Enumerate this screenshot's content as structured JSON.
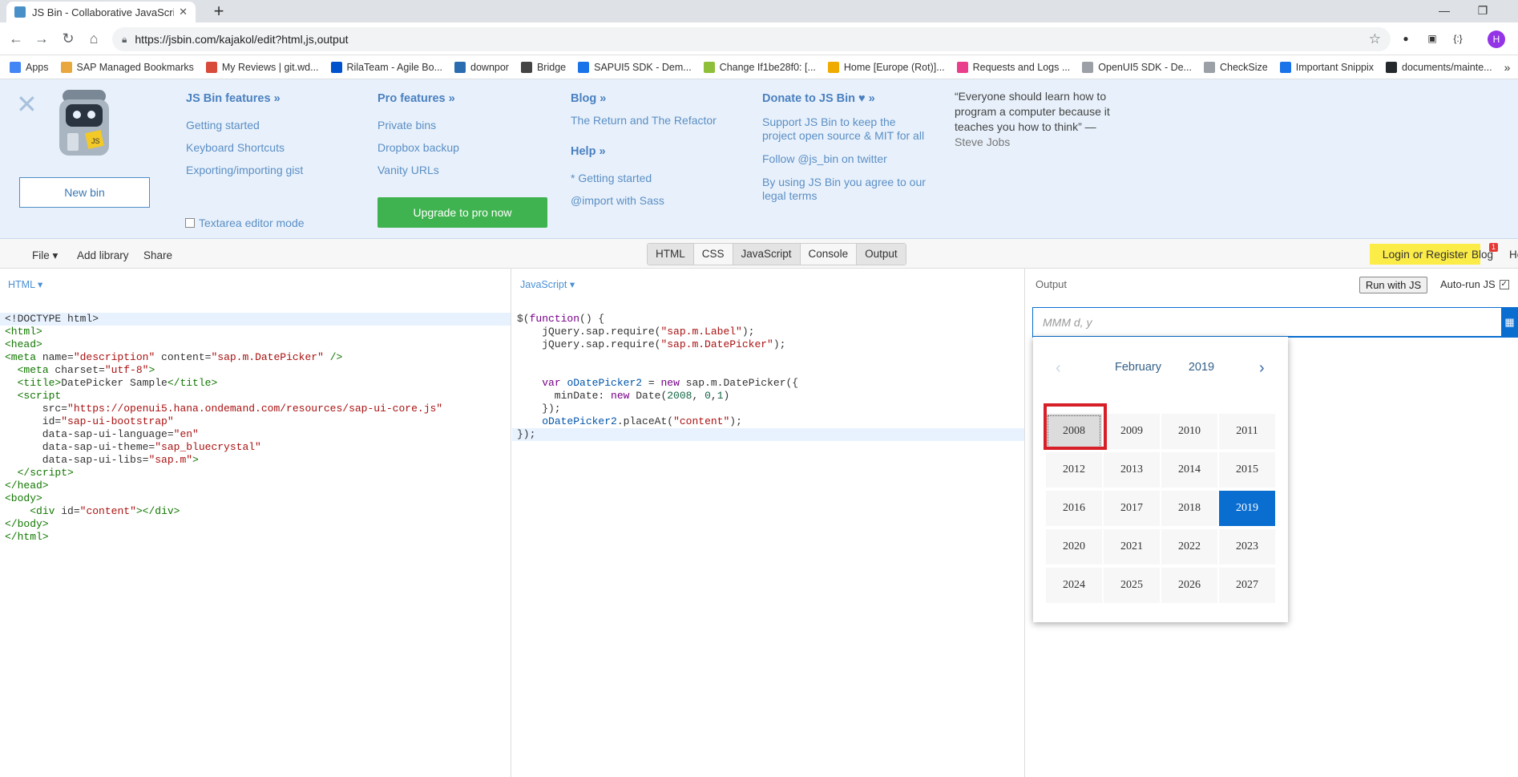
{
  "browser": {
    "tab_title": "JS Bin - Collaborative JavaScript Debugging",
    "url": "https://jsbin.com/kajakol/edit?html,js,output",
    "profile_initial": "H",
    "bookmarks": [
      {
        "label": "Apps",
        "color": "#4285f4"
      },
      {
        "label": "SAP Managed Bookmarks",
        "color": "#e8a83e"
      },
      {
        "label": "My Reviews | git.wd...",
        "color": "#d84a3a"
      },
      {
        "label": "RilaTeam - Agile Bo...",
        "color": "#0052cc"
      },
      {
        "label": "downpor",
        "color": "#2b6cb0"
      },
      {
        "label": "Bridge",
        "color": "#444444"
      },
      {
        "label": "SAPUI5 SDK - Dem...",
        "color": "#1a73e8"
      },
      {
        "label": "Change If1be28f0: [...",
        "color": "#8fbf3a"
      },
      {
        "label": "Home [Europe (Rot)]...",
        "color": "#f0ab00"
      },
      {
        "label": "Requests and Logs ...",
        "color": "#e83e8c"
      },
      {
        "label": "OpenUI5 SDK - De...",
        "color": "#9aa0a6"
      },
      {
        "label": "CheckSize",
        "color": "#9aa0a6"
      },
      {
        "label": "Important Snippix",
        "color": "#1a73e8"
      },
      {
        "label": "documents/mainte...",
        "color": "#24292e"
      }
    ],
    "bookmarks_more": "»"
  },
  "info": {
    "new_bin": "New bin",
    "features_head": "JS Bin features »",
    "features": [
      "Getting started",
      "Keyboard Shortcuts",
      "Exporting/importing gist"
    ],
    "textarea_mode": "Textarea editor mode",
    "pro_head": "Pro features »",
    "pro": [
      "Private bins",
      "Dropbox backup",
      "Vanity URLs"
    ],
    "upgrade": "Upgrade to pro now",
    "blog_head": "Blog »",
    "blog": [
      "The Return and The Refactor"
    ],
    "help_head": "Help »",
    "help": [
      "* Getting started",
      "@import with Sass"
    ],
    "donate_head": "Donate to JS Bin ♥ »",
    "donate": [
      "Support JS Bin to keep the project open source & MIT for all",
      "Follow @js_bin on twitter",
      "By using JS Bin you agree to our legal terms"
    ],
    "quote": "“Everyone should learn how to program a computer because it teaches you how to think” —",
    "quote_author": "Steve Jobs"
  },
  "toolbar": {
    "file": "File ▾",
    "add_library": "Add library",
    "share": "Share",
    "panels": [
      "HTML",
      "CSS",
      "JavaScript",
      "Console",
      "Output"
    ],
    "login": "Login or Register",
    "blog": "Blog",
    "blog_badge": "1",
    "help": "Help"
  },
  "editors": {
    "html_label": "HTML ▾",
    "js_label": "JavaScript ▾",
    "output_label": "Output",
    "run_label": "Run with JS",
    "autorun_label": "Auto-run JS",
    "autorun_check": "✓"
  },
  "datepicker": {
    "placeholder": "MMM d, y",
    "month": "February",
    "year": "2019",
    "years": [
      "2008",
      "2009",
      "2010",
      "2011",
      "2012",
      "2013",
      "2014",
      "2015",
      "2016",
      "2017",
      "2018",
      "2019",
      "2020",
      "2021",
      "2022",
      "2023",
      "2024",
      "2025",
      "2026",
      "2027"
    ],
    "selected_year": "2019",
    "focused_year": "2008",
    "accent": "#0a6ed1",
    "highlight_color": "#d71f28"
  }
}
